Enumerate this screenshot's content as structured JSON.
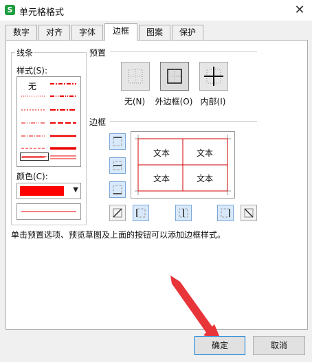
{
  "window": {
    "title": "单元格格式",
    "app_icon": "S",
    "close_glyph": "✕"
  },
  "tabs": [
    {
      "label": "数字"
    },
    {
      "label": "对齐"
    },
    {
      "label": "字体"
    },
    {
      "label": "边框",
      "active": true
    },
    {
      "label": "图案"
    },
    {
      "label": "保护"
    }
  ],
  "line_group": {
    "title": "线条",
    "style_label": "样式(S):",
    "none_label": "无",
    "color_label": "颜色(C):",
    "selected_color": "#ff0000"
  },
  "presets": {
    "title": "预置",
    "items": [
      {
        "label": "无(N)",
        "icon": "border-none-icon"
      },
      {
        "label": "外边框(O)",
        "icon": "border-outside-icon"
      },
      {
        "label": "内部(I)",
        "icon": "border-inside-icon"
      }
    ]
  },
  "border_group": {
    "title": "边框",
    "cells": [
      "文本",
      "文本",
      "文本",
      "文本"
    ]
  },
  "hint_text": "单击预置选项、预览草图及上面的按钮可以添加边框样式。",
  "buttons": {
    "ok": "确定",
    "cancel": "取消"
  }
}
